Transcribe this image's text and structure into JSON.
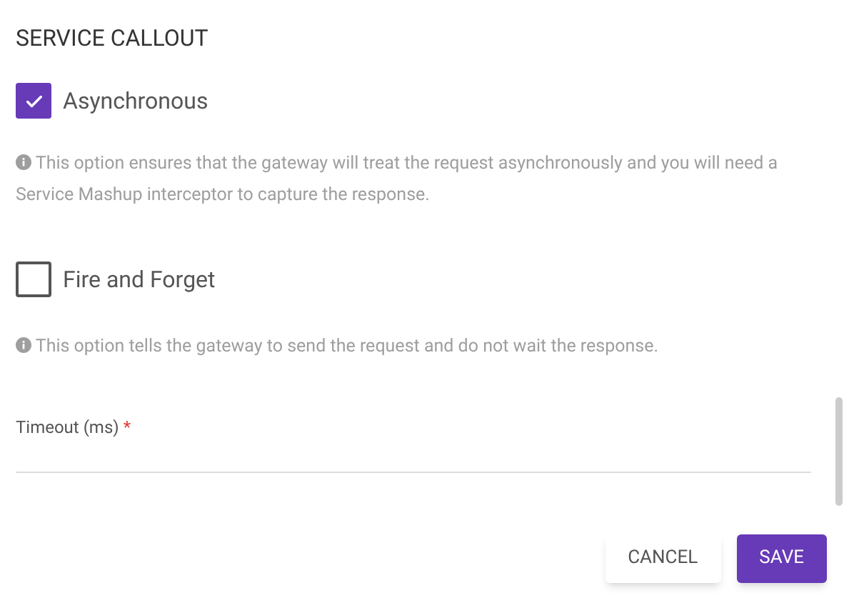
{
  "title": "SERVICE CALLOUT",
  "options": [
    {
      "label": "Asynchronous",
      "checked": true,
      "help": "This option ensures that the gateway will treat the request asynchronously and you will need a Service Mashup interceptor to capture the response."
    },
    {
      "label": "Fire and Forget",
      "checked": false,
      "help": "This option tells the gateway to send the request and do not wait the response."
    }
  ],
  "timeout": {
    "label": "Timeout (ms)",
    "required_mark": "*"
  },
  "buttons": [
    {
      "label": "CANCEL",
      "kind": "secondary"
    },
    {
      "label": "SAVE",
      "kind": "primary"
    }
  ]
}
